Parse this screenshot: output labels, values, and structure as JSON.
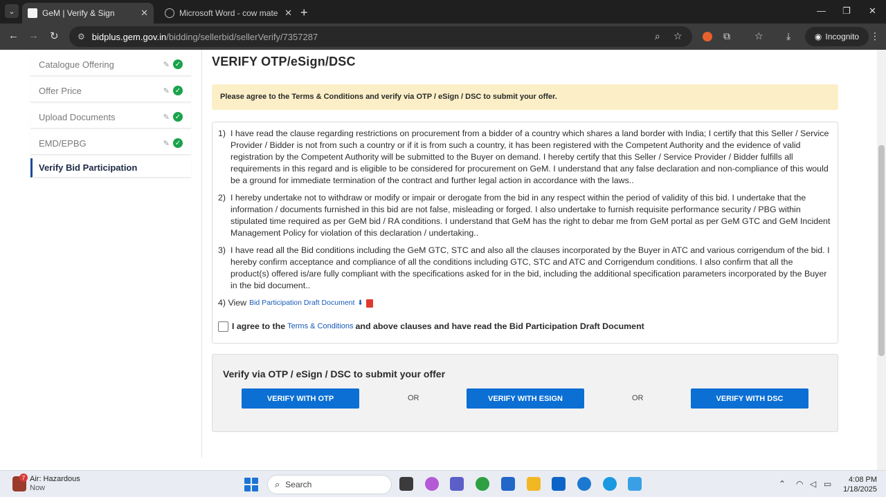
{
  "browser": {
    "tabs": [
      {
        "title": "GeM | Verify & Sign",
        "active": true
      },
      {
        "title": "Microsoft Word - cow mate bid",
        "active": false
      }
    ],
    "url_host": "bidplus.gem.gov.in",
    "url_path": "/bidding/sellerbid/sellerVerify/7357287",
    "profile_label": "Incognito"
  },
  "sidebar": {
    "items": [
      {
        "label": "Catalogue Offering"
      },
      {
        "label": "Offer Price"
      },
      {
        "label": "Upload Documents"
      },
      {
        "label": "EMD/EPBG"
      },
      {
        "label": "Verify Bid Participation"
      }
    ]
  },
  "main": {
    "heading": "VERIFY OTP/eSign/DSC",
    "notice": "Please agree to the Terms & Conditions and verify via OTP / eSign / DSC to submit your offer.",
    "clauses": [
      {
        "num": "1)",
        "text": "I have read the clause regarding restrictions on procurement from a bidder of a country which shares a land border with India; I certify that this Seller / Service Provider / Bidder is not from such a country or if it is from such a country, it has been registered with the Competent Authority and the evidence of valid registration by the Competent Authority will be submitted to the Buyer on demand. I hereby certify that this Seller / Service Provider / Bidder fulfills all requirements in this regard and is eligible to be considered for procurement on GeM. I understand that any false declaration and non-compliance of this would be a ground for immediate termination of the contract and further legal action in accordance with the laws.."
      },
      {
        "num": "2)",
        "text": "I hereby undertake not to withdraw or modify or impair or derogate from the bid in any respect within the period of validity of this bid. I undertake that the information / documents furnished in this bid are not false, misleading or forged. I also undertake to furnish requisite performance security / PBG within stipulated time required as per GeM bid / RA conditions. I understand that GeM has the right to debar me from GeM portal as per GeM GTC and GeM Incident Management Policy for violation of this declaration / undertaking.."
      },
      {
        "num": "3)",
        "text": "I have read all the Bid conditions including the GeM GTC, STC and also all the clauses incorporated by the Buyer in ATC and various corrigendum of the bid. I hereby confirm acceptance and compliance of all the conditions including GTC, STC and ATC and Corrigendum conditions. I also confirm that all the product(s) offered is/are fully compliant with the specifications asked for in the bid, including the additional specification parameters incorporated by the Buyer in the bid document.."
      }
    ],
    "view_prefix": "4) View",
    "view_link": "Bid Participation Draft Document",
    "agree_prefix": "I agree to the",
    "agree_link": "Terms & Conditions",
    "agree_suffix": "and above clauses and have read the Bid Participation Draft Document",
    "verify_title": "Verify via OTP / eSign / DSC to submit your offer",
    "buttons": {
      "otp": "VERIFY WITH OTP",
      "esign": "VERIFY WITH ESIGN",
      "dsc": "VERIFY WITH DSC"
    },
    "or_label": "OR"
  },
  "taskbar": {
    "weather_title": "Air: Hazardous",
    "weather_sub": "Now",
    "weather_badge": "7",
    "search_placeholder": "Search",
    "time": "4:08 PM",
    "date": "1/18/2025"
  },
  "colors": {
    "primary_button": "#0b6fd4",
    "notice_bg": "#fcefc7",
    "check_green": "#1aa34a",
    "link": "#1859b8"
  }
}
